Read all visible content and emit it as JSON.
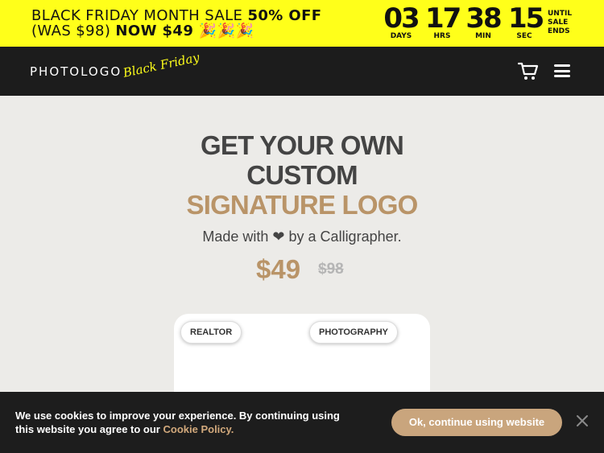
{
  "promo": {
    "line1_prefix": "BLACK FRIDAY MONTH SALE ",
    "line1_strong": "50% OFF",
    "line2_prefix": "(WAS $98) ",
    "line2_strong": "NOW $49 🎉🎉🎉"
  },
  "countdown": [
    {
      "value": "03",
      "unit": "DAYS"
    },
    {
      "value": "17",
      "unit": "HRS"
    },
    {
      "value": "38",
      "unit": "MIN"
    },
    {
      "value": "15",
      "unit": "SEC"
    }
  ],
  "countdown_suffix": [
    "UNTIL",
    "SALE",
    "ENDS"
  ],
  "nav": {
    "logo": "PHOTOLOGO",
    "logo_script": "Black Friday",
    "cart_icon": "cart-icon",
    "menu_icon": "hamburger-menu-icon"
  },
  "hero": {
    "line1": "GET YOUR OWN",
    "line2": "CUSTOM",
    "line3": "SIGNATURE LOGO",
    "sub_before": "Made with",
    "sub_heart": "❤",
    "sub_after": "by a Calligrapher.",
    "price": "$49",
    "old_price": "$98"
  },
  "card": {
    "tags": [
      "REALTOR",
      "PHOTOGRAPHY"
    ]
  },
  "cookie": {
    "text": "We use cookies to improve your experience. By continuing using this website you agree to our",
    "link": "Cookie Policy.",
    "button": "Ok, continue using website",
    "close_icon": "close-icon"
  },
  "colors": {
    "promo_bg": "#ffff1a",
    "nav_bg": "#1c1c1c",
    "accent": "#b99468",
    "button": "#c9a57d",
    "page_bg": "#ecebe8"
  }
}
